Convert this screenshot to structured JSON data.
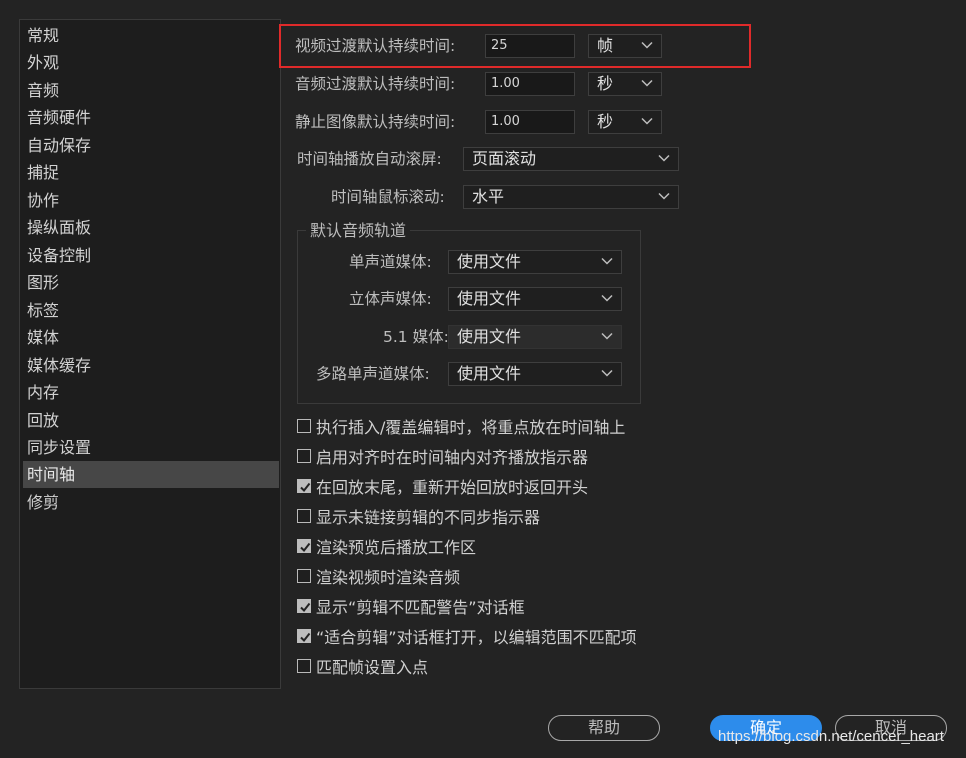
{
  "sidebar": {
    "items": [
      {
        "label": "常规"
      },
      {
        "label": "外观"
      },
      {
        "label": "音频"
      },
      {
        "label": "音频硬件"
      },
      {
        "label": "自动保存"
      },
      {
        "label": "捕捉"
      },
      {
        "label": "协作"
      },
      {
        "label": "操纵面板"
      },
      {
        "label": "设备控制"
      },
      {
        "label": "图形"
      },
      {
        "label": "标签"
      },
      {
        "label": "媒体"
      },
      {
        "label": "媒体缓存"
      },
      {
        "label": "内存"
      },
      {
        "label": "回放"
      },
      {
        "label": "同步设置"
      },
      {
        "label": "时间轴"
      },
      {
        "label": "修剪"
      }
    ],
    "active": "时间轴"
  },
  "settings": {
    "video_transition": {
      "label": "视频过渡默认持续时间:",
      "value": "25",
      "unit": "帧"
    },
    "audio_transition": {
      "label": "音频过渡默认持续时间:",
      "value": "1.00",
      "unit": "秒"
    },
    "still_image": {
      "label": "静止图像默认持续时间:",
      "value": "1.00",
      "unit": "秒"
    },
    "timeline_autoscroll": {
      "label": "时间轴播放自动滚屏:",
      "value": "页面滚动"
    },
    "timeline_mouse_scroll": {
      "label": "时间轴鼠标滚动:",
      "value": "水平"
    }
  },
  "default_audio_tracks": {
    "title": "默认音频轨道",
    "mono": {
      "label": "单声道媒体:",
      "value": "使用文件"
    },
    "stereo": {
      "label": "立体声媒体:",
      "value": "使用文件"
    },
    "surround": {
      "label": "5.1 媒体:",
      "value": "使用文件"
    },
    "multi_mono": {
      "label": "多路单声道媒体:",
      "value": "使用文件"
    }
  },
  "checkboxes": [
    {
      "label": "执行插入/覆盖编辑时，将重点放在时间轴上",
      "checked": false
    },
    {
      "label": "启用对齐时在时间轴内对齐播放指示器",
      "checked": false
    },
    {
      "label": "在回放末尾，重新开始回放时返回开头",
      "checked": true
    },
    {
      "label": "显示未链接剪辑的不同步指示器",
      "checked": false
    },
    {
      "label": "渲染预览后播放工作区",
      "checked": true
    },
    {
      "label": "渲染视频时渲染音频",
      "checked": false
    },
    {
      "label": "显示“剪辑不匹配警告”对话框",
      "checked": true
    },
    {
      "label": "“适合剪辑”对话框打开，以编辑范围不匹配项",
      "checked": true
    },
    {
      "label": "匹配帧设置入点",
      "checked": false
    }
  ],
  "buttons": {
    "help": "帮助",
    "ok": "确定",
    "cancel": "取消"
  },
  "watermark": "https://blog.csdn.net/cencer_heart",
  "colors": {
    "accent": "#2d8ceb",
    "highlight": "#e02a2a",
    "background": "#232323"
  }
}
